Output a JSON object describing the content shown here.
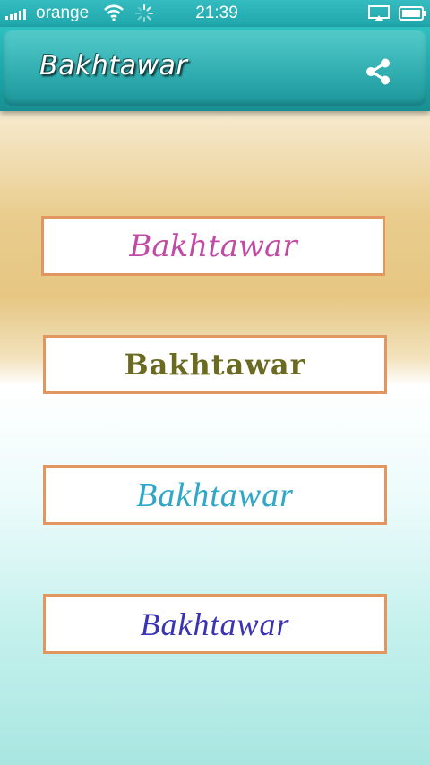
{
  "status_bar": {
    "carrier": "orange",
    "time": "21:39",
    "icons": [
      "signal-icon",
      "wifi-icon",
      "activity-icon",
      "airplay-icon",
      "battery-icon"
    ]
  },
  "header": {
    "title": "Bakhtawar",
    "share_icon": "share-icon"
  },
  "options": [
    {
      "label": "Bakhtawar",
      "color": "#c04aa4"
    },
    {
      "label": "Bakhtawar",
      "color": "#6b6a22"
    },
    {
      "label": "Bakhtawar",
      "color": "#2fa7c9"
    },
    {
      "label": "Bakhtawar",
      "color": "#3a34b4"
    }
  ],
  "colors": {
    "accent": "#1fa8ac",
    "card_border": "#e1975f"
  }
}
